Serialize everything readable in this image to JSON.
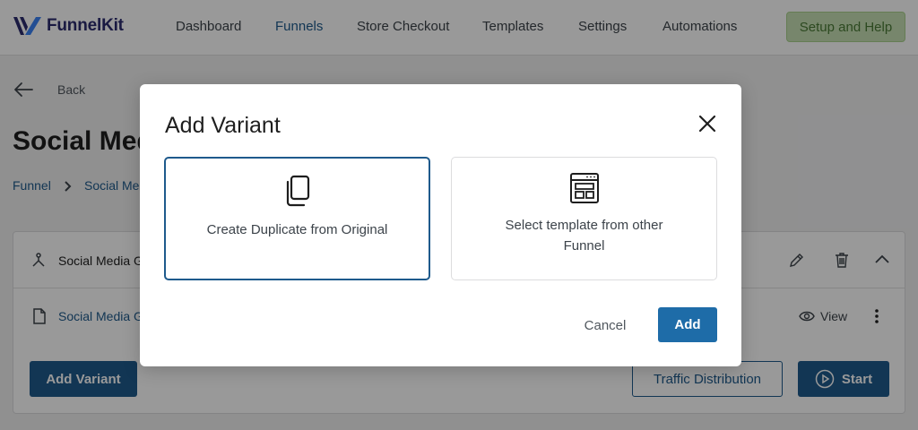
{
  "app": {
    "logo_text": "FunnelKit"
  },
  "nav": {
    "items": [
      {
        "label": "Dashboard"
      },
      {
        "label": "Funnels"
      },
      {
        "label": "Store Checkout"
      },
      {
        "label": "Templates"
      },
      {
        "label": "Settings"
      },
      {
        "label": "Automations"
      }
    ],
    "active": "Funnels",
    "setup_label": "Setup and Help"
  },
  "page": {
    "back_label": "Back",
    "title": "Social Media",
    "breadcrumb": [
      "Funnel",
      "Social Media"
    ],
    "step_title": "Social Media Giveaway",
    "variant_name": "Social Media Giveaway",
    "view_label": "View",
    "add_variant_label": "Add Variant",
    "traffic_label": "Traffic Distribution",
    "start_label": "Start"
  },
  "modal": {
    "title": "Add Variant",
    "options": [
      {
        "label": "Create Duplicate from Original",
        "icon": "duplicate-icon",
        "selected": true
      },
      {
        "label": "Select template from other Funnel",
        "icon": "template-icon",
        "selected": false
      }
    ],
    "cancel_label": "Cancel",
    "add_label": "Add"
  },
  "colors": {
    "primary": "#1e5a8c",
    "add_button": "#1e6ca8",
    "setup_bg": "#c7e0b4",
    "overlay": "rgba(0,0,0,0.4)"
  }
}
